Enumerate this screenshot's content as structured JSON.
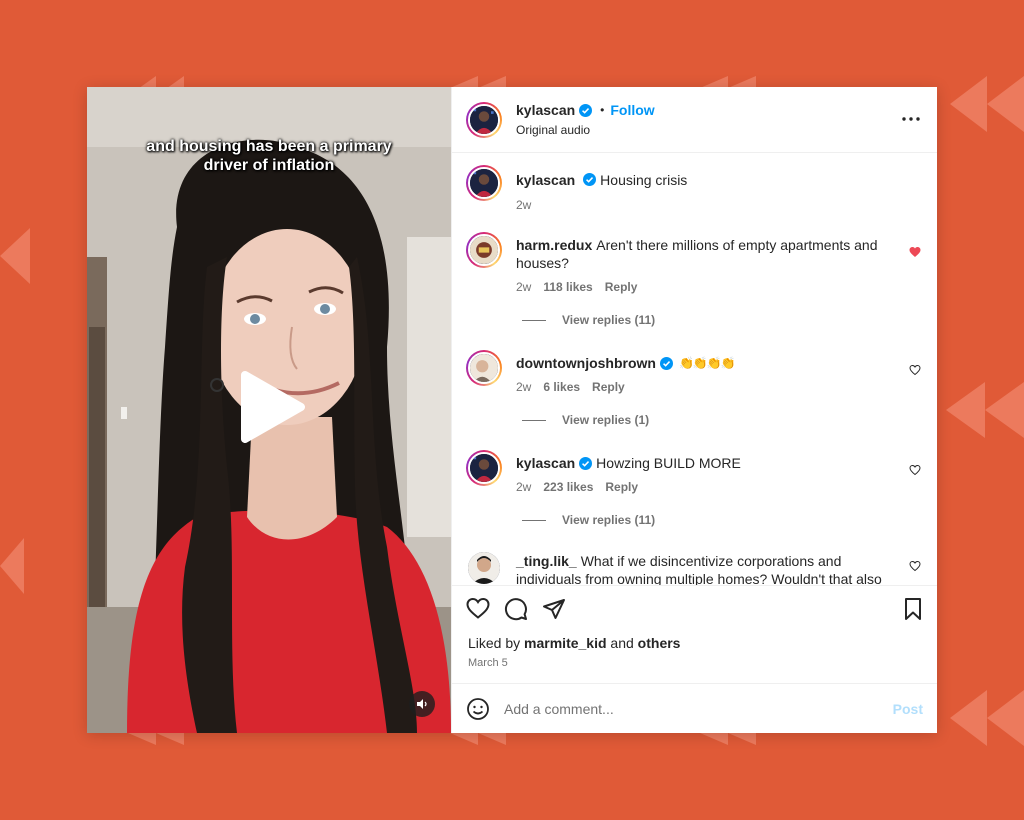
{
  "colors": {
    "background": "#e05a37",
    "accent_blue": "#0095f6",
    "like_red": "#ed4956",
    "muted_text": "#737373"
  },
  "video": {
    "caption": "and housing has been a primary driver of inflation",
    "play_icon": "play-icon",
    "mute_icon": "speaker-icon"
  },
  "header": {
    "username": "kylascan",
    "dot": "•",
    "follow_label": "Follow",
    "subtitle": "Original audio",
    "more_icon": "more-horizontal-icon"
  },
  "caption_post": {
    "username": "kylascan",
    "text": "Housing crisis",
    "time": "2w"
  },
  "comments": [
    {
      "username": "harm.redux",
      "text": "Aren't there millions of empty apartments and houses?",
      "time": "2w",
      "likes": "118 likes",
      "reply_label": "Reply",
      "liked": true,
      "view_replies": "View replies (11)"
    },
    {
      "username": "downtownjoshbrown",
      "text": "👏👏👏👏",
      "time": "2w",
      "likes": "6 likes",
      "reply_label": "Reply",
      "liked": false,
      "view_replies": "View replies (1)"
    },
    {
      "username": "kylascan",
      "text": "Howzing BUILD MORE",
      "time": "2w",
      "likes": "223 likes",
      "reply_label": "Reply",
      "liked": false,
      "view_replies": "View replies (11)"
    },
    {
      "username": "_ting.lik_",
      "text": "What if we disincentivize corporations and individuals from owning multiple homes? Wouldn't that also",
      "liked": false
    }
  ],
  "actions": {
    "like_icon": "heart-icon",
    "comment_icon": "comment-icon",
    "share_icon": "send-icon",
    "save_icon": "bookmark-icon"
  },
  "liked_by": {
    "prefix": "Liked by",
    "user": "marmite_kid",
    "conj": "and",
    "others": "others"
  },
  "post_date": "March 5",
  "add_comment": {
    "placeholder": "Add a comment...",
    "post_label": "Post",
    "emoji_icon": "smiley-icon"
  }
}
